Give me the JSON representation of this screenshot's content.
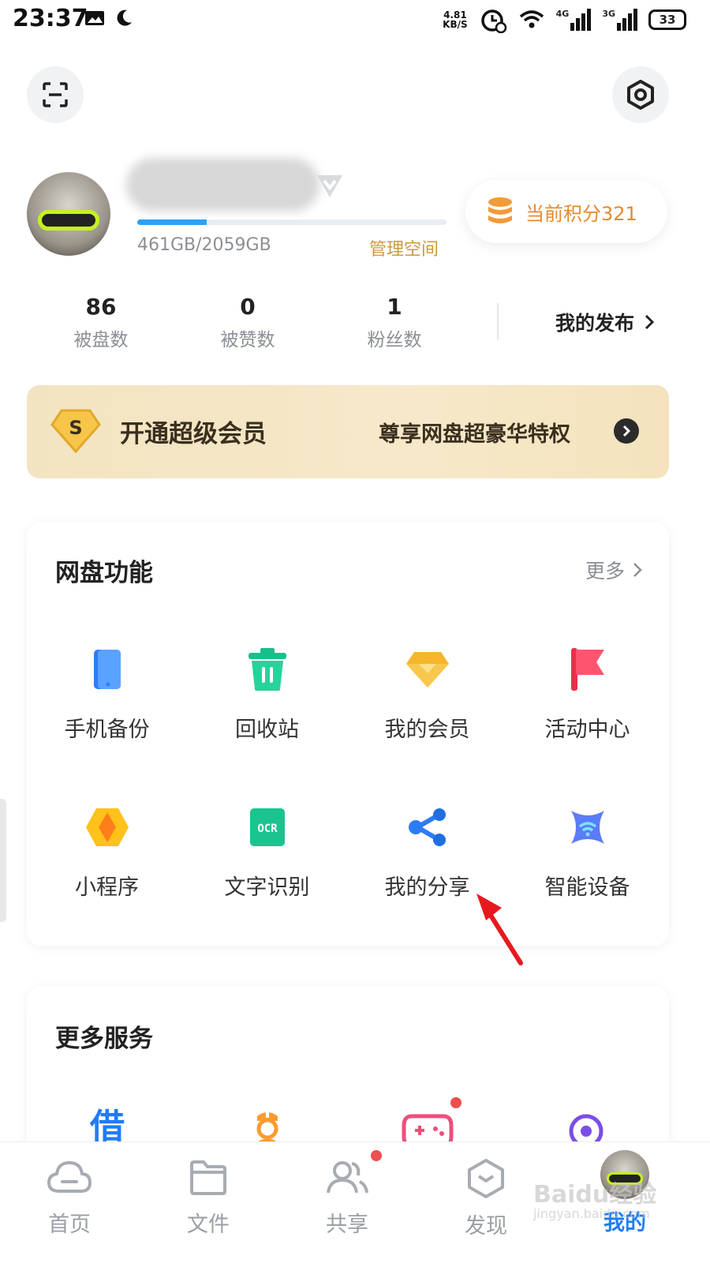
{
  "status_bar": {
    "time": "23:37",
    "net_speed_value": "4.81",
    "net_speed_unit": "KB/S",
    "signal_4g": "4G",
    "signal_3g": "3G",
    "battery": "33"
  },
  "profile": {
    "storage_used_fraction": 0.224,
    "storage_text": "461GB/2059GB",
    "manage_space": "管理空间",
    "points": "当前积分321"
  },
  "stats": [
    {
      "value": "86",
      "label": "被盘数"
    },
    {
      "value": "0",
      "label": "被赞数"
    },
    {
      "value": "1",
      "label": "粉丝数"
    }
  ],
  "my_publish": "我的发布",
  "vip_banner": {
    "badge": "S",
    "title": "开通超级会员",
    "subtitle": "尊享网盘超豪华特权"
  },
  "features_card": {
    "title": "网盘功能",
    "more": "更多",
    "items": [
      {
        "label": "手机备份",
        "icon": "phone-backup-icon"
      },
      {
        "label": "回收站",
        "icon": "trash-icon"
      },
      {
        "label": "我的会员",
        "icon": "diamond-icon"
      },
      {
        "label": "活动中心",
        "icon": "flag-icon"
      },
      {
        "label": "小程序",
        "icon": "mini-program-icon"
      },
      {
        "label": "文字识别",
        "icon": "ocr-icon",
        "icon_text": "OCR"
      },
      {
        "label": "我的分享",
        "icon": "share-icon"
      },
      {
        "label": "智能设备",
        "icon": "smart-device-icon"
      }
    ]
  },
  "services_card": {
    "title": "更多服务",
    "items": [
      {
        "icon": "loan-icon",
        "icon_text": "借"
      },
      {
        "icon": "nurse-icon"
      },
      {
        "icon": "gamepad-icon"
      },
      {
        "icon": "location-icon"
      }
    ]
  },
  "bottom_nav": [
    {
      "label": "首页",
      "icon": "cloud-icon"
    },
    {
      "label": "文件",
      "icon": "folder-icon"
    },
    {
      "label": "共享",
      "icon": "people-icon"
    },
    {
      "label": "发现",
      "icon": "discover-icon"
    },
    {
      "label": "我的",
      "icon": "avatar-icon",
      "active": true
    }
  ],
  "watermark": {
    "text": "Baidu经验",
    "sub": "jingyan.baidu.com"
  },
  "colors": {
    "accent_blue": "#1f7cf5",
    "storage_bar": "#2aa2f5",
    "points_orange": "#e58a2c",
    "manage_gold": "#c99a3d",
    "badge_red": "#f04e4e"
  }
}
